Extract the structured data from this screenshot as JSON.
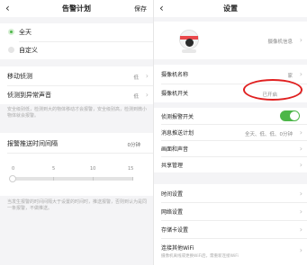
{
  "left": {
    "header": {
      "back": "‹",
      "title": "告警计划",
      "save": "保存"
    },
    "plan_options": [
      {
        "label": "全天",
        "selected": true
      },
      {
        "label": "自定义",
        "selected": false
      }
    ],
    "motion": {
      "label": "移动侦测",
      "value": "低"
    },
    "sound": {
      "label": "侦测到异常声音",
      "value": "低"
    },
    "sensitivity_note": "安全级别低，检测到大的物体移动才会报警，安全级别高，检测到微小物体就会报警。",
    "interval": {
      "label": "报警推送时间间隔",
      "value": "0分钟",
      "ticks": [
        "0",
        "5",
        "10",
        "15"
      ],
      "position": 0
    },
    "interval_note": "当发生报警的时间间隔大于设置的时间时，推送报警，否则到认为是同一条报警，不做推送。"
  },
  "right": {
    "header": {
      "back": "‹",
      "title": "设置"
    },
    "camera_info_label": "摄像机信息",
    "rows": {
      "name": {
        "label": "摄像机名称",
        "value": "家"
      },
      "switch": {
        "label": "摄像机开关",
        "value": "已开启"
      },
      "alarm_switch": {
        "label": "侦测报警开关",
        "on": true
      },
      "push_plan": {
        "label": "消息推送计划",
        "value": "全天、低、低、0分钟"
      },
      "video_audio": {
        "label": "画面和声音"
      },
      "share": {
        "label": "共享管理"
      },
      "time": {
        "label": "时间设置"
      },
      "network": {
        "label": "网络设置"
      },
      "storage": {
        "label": "存储卡设置"
      },
      "wifi": {
        "label": "连接其他WiFi",
        "sub": "摄像机离线或更换WiFi后，需重新连接WiFi"
      }
    },
    "highlight_color": "#e02020",
    "accent_color": "#4cb648"
  }
}
